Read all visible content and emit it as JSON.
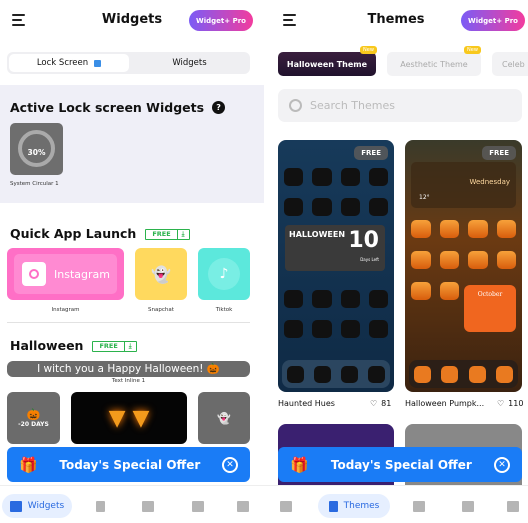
{
  "left": {
    "title": "Widgets",
    "pro_button": "Widget+ Pro",
    "segments": [
      "Lock Screen",
      "Widgets"
    ],
    "active_section": {
      "title": "Active Lock screen Widgets",
      "help": "?",
      "widget": {
        "value": "30%",
        "label": "System Circular 1"
      }
    },
    "quick_launch": {
      "title": "Quick App Launch",
      "badge": "FREE",
      "download": "⤓",
      "items": [
        {
          "label": "Instagram",
          "text": "Instagram",
          "color": "#ff6fc6"
        },
        {
          "label": "Snapchat",
          "color": "#ffd95e"
        },
        {
          "label": "Tiktok",
          "color": "#5ce8dc"
        }
      ]
    },
    "halloween": {
      "title": "Halloween",
      "badge": "FREE",
      "download": "⤓",
      "text_widget": "I witch you a Happy Halloween! 🎃",
      "text_label": "Text Inline 1",
      "countdown": "-20 DAYS"
    },
    "offer": "Today's Special Offer",
    "nav": {
      "active": "Widgets"
    }
  },
  "right": {
    "title": "Themes",
    "pro_button": "Widget+ Pro",
    "chips": [
      {
        "label": "Halloween Theme",
        "badge": "New"
      },
      {
        "label": "Aesthetic Theme",
        "badge": "New"
      },
      {
        "label": "Celeb"
      }
    ],
    "search_placeholder": "Search Themes",
    "cards": [
      {
        "name": "Haunted Hues",
        "likes": "81",
        "badge": "FREE",
        "widget_title": "HALLOWEEN",
        "days": "10",
        "days_label": "Days Left"
      },
      {
        "name": "Halloween Pumpk...",
        "likes": "110",
        "badge": "FREE",
        "day": "Wednesday",
        "temp": "12°",
        "calendar": "October"
      }
    ],
    "offer": "Today's Special Offer",
    "nav": {
      "active": "Themes"
    }
  },
  "colors": {
    "accent": "#1a7cf6",
    "free": "#2bb24c"
  }
}
